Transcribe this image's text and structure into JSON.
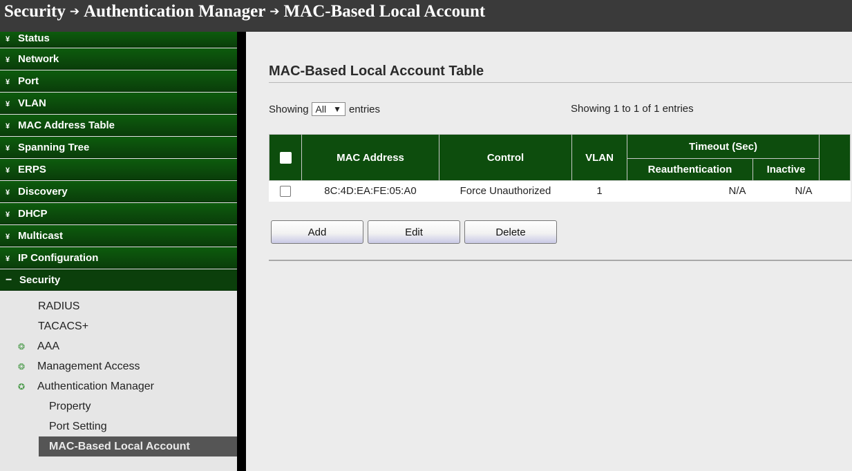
{
  "breadcrumb": [
    "Security",
    "Authentication Manager",
    "MAC-Based Local Account"
  ],
  "sidebar": {
    "menus": [
      {
        "label": "Status"
      },
      {
        "label": "Network"
      },
      {
        "label": "Port"
      },
      {
        "label": "VLAN"
      },
      {
        "label": "MAC Address Table"
      },
      {
        "label": "Spanning Tree"
      },
      {
        "label": "ERPS"
      },
      {
        "label": "Discovery"
      },
      {
        "label": "DHCP"
      },
      {
        "label": "Multicast"
      },
      {
        "label": "IP Configuration"
      }
    ],
    "open_menu": "Security",
    "sub": {
      "radius": "RADIUS",
      "tacacs": "TACACS+",
      "aaa": "AAA",
      "management_access": "Management Access",
      "authentication_manager": "Authentication Manager",
      "property": "Property",
      "port_setting": "Port Setting",
      "mac_based_local_account": "MAC-Based Local Account"
    }
  },
  "main": {
    "title": "MAC-Based Local Account Table",
    "showing_prefix": "Showing",
    "showing_value": "All",
    "showing_suffix": "entries",
    "summary": "Showing 1 to 1 of 1 entries",
    "table": {
      "headers": {
        "mac": "MAC Address",
        "control": "Control",
        "vlan": "VLAN",
        "timeout": "Timeout (Sec)",
        "reauth": "Reauthentication",
        "inactive": "Inactive"
      },
      "rows": [
        {
          "mac": "8C:4D:EA:FE:05:A0",
          "control": "Force Unauthorized",
          "vlan": "1",
          "reauth": "N/A",
          "inactive": "N/A"
        }
      ]
    },
    "buttons": {
      "add": "Add",
      "edit": "Edit",
      "delete": "Delete"
    }
  }
}
